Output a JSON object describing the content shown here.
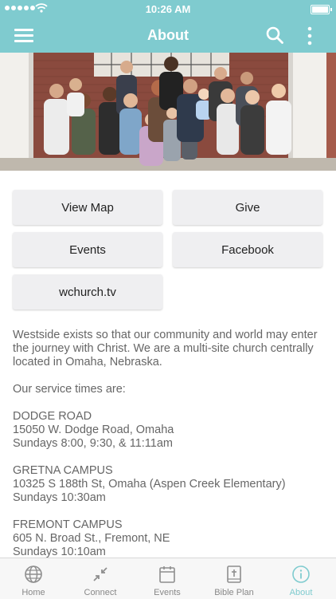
{
  "status_bar": {
    "time": "10:26 AM"
  },
  "header": {
    "title": "About"
  },
  "buttons": [
    {
      "label": "View Map"
    },
    {
      "label": "Give"
    },
    {
      "label": "Events"
    },
    {
      "label": "Facebook"
    },
    {
      "label": "wchurch.tv"
    }
  ],
  "description": {
    "intro": "Westside exists so that our community and world may enter the journey with Christ. We are a multi-site church centrally located in Omaha, Nebraska.",
    "service_heading": "Our service times are:",
    "campuses": [
      {
        "name": "DODGE ROAD",
        "address": "15050 W. Dodge Road, Omaha",
        "times": "Sundays 8:00, 9:30, & 11:11am"
      },
      {
        "name": "GRETNA CAMPUS",
        "address": "10325 S 188th St, Omaha (Aspen Creek Elementary)",
        "times": "Sundays 10:30am"
      },
      {
        "name": "FREMONT CAMPUS",
        "address": "605 N. Broad St., Fremont, NE",
        "times": "Sundays 10:10am"
      }
    ]
  },
  "tabs": [
    {
      "label": "Home",
      "icon": "globe-icon"
    },
    {
      "label": "Connect",
      "icon": "connect-arrows-icon"
    },
    {
      "label": "Events",
      "icon": "calendar-icon"
    },
    {
      "label": "Bible Plan",
      "icon": "bible-icon"
    },
    {
      "label": "About",
      "icon": "info-icon",
      "active": true
    }
  ],
  "colors": {
    "accent": "#7fcbcf",
    "button_bg": "#efeff1",
    "body_text": "#666666",
    "tab_inactive": "#888888"
  }
}
